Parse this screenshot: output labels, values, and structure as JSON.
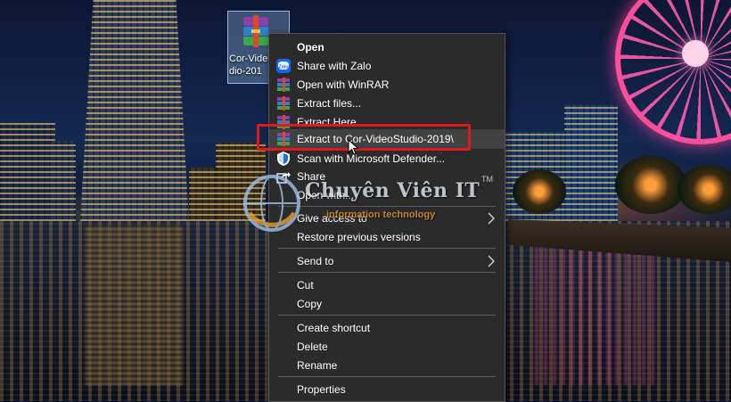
{
  "desktop": {
    "file_icon": {
      "name": "winrar-archive-icon",
      "label": "Cor-Video\ndio-201"
    }
  },
  "context_menu": {
    "items": [
      {
        "label": "Open",
        "bold": true,
        "icon": "none"
      },
      {
        "label": "Share with Zalo",
        "icon": "zalo-icon"
      },
      {
        "label": "Open with WinRAR",
        "icon": "winrar-icon"
      },
      {
        "label": "Extract files...",
        "icon": "winrar-icon"
      },
      {
        "label": "Extract Here",
        "icon": "winrar-icon"
      },
      {
        "label": "Extract to Cor-VideoStudio-2019\\",
        "icon": "winrar-icon",
        "hovered": true,
        "highlighted": true
      },
      {
        "label": "Scan with Microsoft Defender...",
        "icon": "defender-shield-icon"
      },
      {
        "label": "Share",
        "icon": "share-icon"
      },
      {
        "label": "Open with...",
        "icon": "none"
      },
      {
        "label": "Give access to",
        "icon": "none",
        "submenu": true
      },
      {
        "label": "Restore previous versions",
        "icon": "none"
      },
      {
        "label": "Send to",
        "icon": "none",
        "submenu": true
      },
      {
        "label": "Cut",
        "icon": "none"
      },
      {
        "label": "Copy",
        "icon": "none"
      },
      {
        "label": "Create shortcut",
        "icon": "none"
      },
      {
        "label": "Delete",
        "icon": "none"
      },
      {
        "label": "Rename",
        "icon": "none"
      },
      {
        "label": "Properties",
        "icon": "none"
      }
    ],
    "highlight_color": "#e01a1a",
    "background_color": "#2b2b2b"
  },
  "watermark": {
    "title": "Chuyên Viên IT",
    "trademark": "TM",
    "subtitle": "information technology",
    "accent_color": "#f0a030"
  },
  "cursor": {
    "icon": "mouse-pointer-icon"
  }
}
